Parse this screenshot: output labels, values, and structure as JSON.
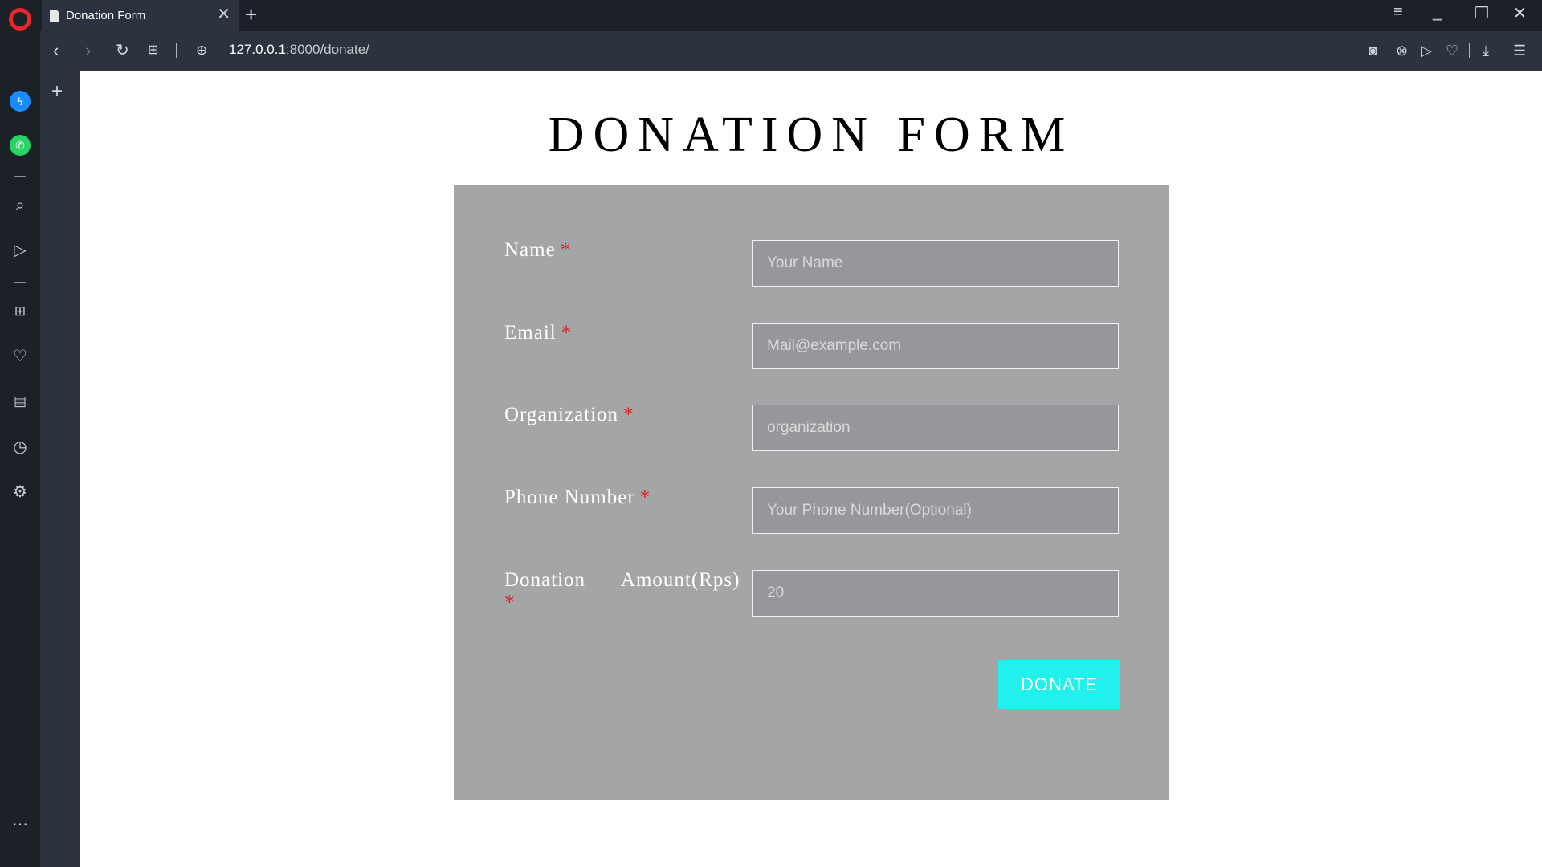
{
  "browser": {
    "tab_title": "Donation Form",
    "url_host": "127.0.0.1",
    "url_path": ":8000/donate/"
  },
  "page": {
    "title": "DONATION FORM",
    "fields": [
      {
        "label": "Name",
        "required_mark": "*",
        "placeholder": "Your Name"
      },
      {
        "label": "Email",
        "required_mark": "*",
        "placeholder": "Mail@example.com"
      },
      {
        "label": "Organization",
        "required_mark": "*",
        "placeholder": "organization"
      },
      {
        "label": "Phone Number",
        "required_mark": "*",
        "placeholder": "Your Phone Number(Optional)"
      },
      {
        "label": "Donation Amount(Rps)",
        "required_mark": "*",
        "placeholder": "20"
      }
    ],
    "submit_label": "DONATE"
  },
  "colors": {
    "form_background": "#a3a5a7",
    "button": "#22f0ec",
    "required": "#e3201b"
  }
}
